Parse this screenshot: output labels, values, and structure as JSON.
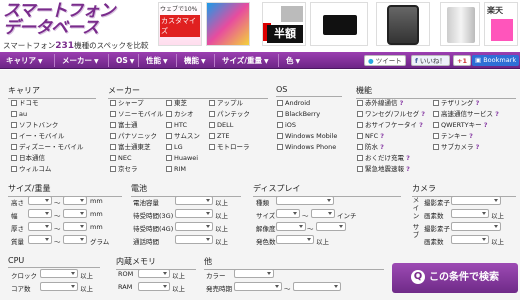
{
  "logo": {
    "line1": "スマートフォン",
    "line2": "データベース",
    "sub_prefix": "スマートフォン",
    "count": "231",
    "sub_suffix": "機種のスペックを比較"
  },
  "ads": {
    "ad1_top": "ウェブで10%",
    "ad1_label": "カスタマイズ",
    "ad3_label": "半額",
    "ad7_label": "楽天"
  },
  "nav": {
    "items": [
      "キャリア",
      "メーカー",
      "OS",
      "性能",
      "機能",
      "サイズ/重量",
      "色"
    ],
    "arrow": "▼",
    "tweet": "ツイート",
    "like": "いいね！",
    "plus": "+1",
    "bookmark": "Bookmark"
  },
  "carrier": {
    "title": "キャリア",
    "items": [
      "ドコモ",
      "au",
      "ソフトバンク",
      "イー・モバイル",
      "ディズニー・モバイル",
      "日本通信",
      "ウィルコム"
    ]
  },
  "maker": {
    "title": "メーカー",
    "items": [
      "シャープ",
      "ソニーモバイル",
      "富士通",
      "パナソニック",
      "富士通東芝",
      "NEC",
      "京セラ",
      "東芝",
      "カシオ",
      "HTC",
      "サムスン",
      "LG",
      "Huawei",
      "RIM",
      "アップル",
      "パンテック",
      "DELL",
      "ZTE",
      "モトローラ"
    ]
  },
  "os": {
    "title": "OS",
    "items": [
      "Android",
      "BlackBerry",
      "iOS",
      "Windows Mobile",
      "Windows Phone"
    ]
  },
  "features": {
    "title": "機能",
    "items": [
      "赤外線通信",
      "ワンセグ/フルセグ",
      "おサイフケータイ",
      "NFC",
      "防水",
      "おくだけ充電",
      "緊急地震速報",
      "テザリング",
      "高速通信サービス",
      "QWERTYキー",
      "テンキー",
      "サブカメラ"
    ],
    "mark": "?"
  },
  "size": {
    "title": "サイズ/重量",
    "rows": [
      "高さ",
      "幅",
      "厚さ",
      "質量"
    ],
    "units": [
      "mm",
      "mm",
      "mm",
      "グラム"
    ],
    "tilde": "〜"
  },
  "battery": {
    "title": "電池",
    "rows": [
      "電池容量",
      "待受時間(3G)",
      "待受時間(4G)",
      "通話時間"
    ]
  },
  "display": {
    "title": "ディスプレイ",
    "rows": [
      "種類",
      "サイズ",
      "解像度",
      "発色数"
    ],
    "size_unit": "インチ",
    "tilde": "〜",
    "x": "×"
  },
  "camera": {
    "title": "カメラ",
    "side_main": "メイン",
    "side_sub": "サブ",
    "rows": [
      "撮影素子",
      "画素数",
      "撮影素子",
      "画素数"
    ]
  },
  "cpu": {
    "title": "CPU",
    "rows": [
      "クロック",
      "コア数"
    ]
  },
  "memory": {
    "title": "内蔵メモリ",
    "rows": [
      "ROM",
      "RAM"
    ]
  },
  "other": {
    "title": "他",
    "rows": [
      "カラー",
      "発売時期"
    ],
    "tilde": "〜"
  },
  "ijo": "以上",
  "search_button": "この条件で検索",
  "search_icon": "Q"
}
